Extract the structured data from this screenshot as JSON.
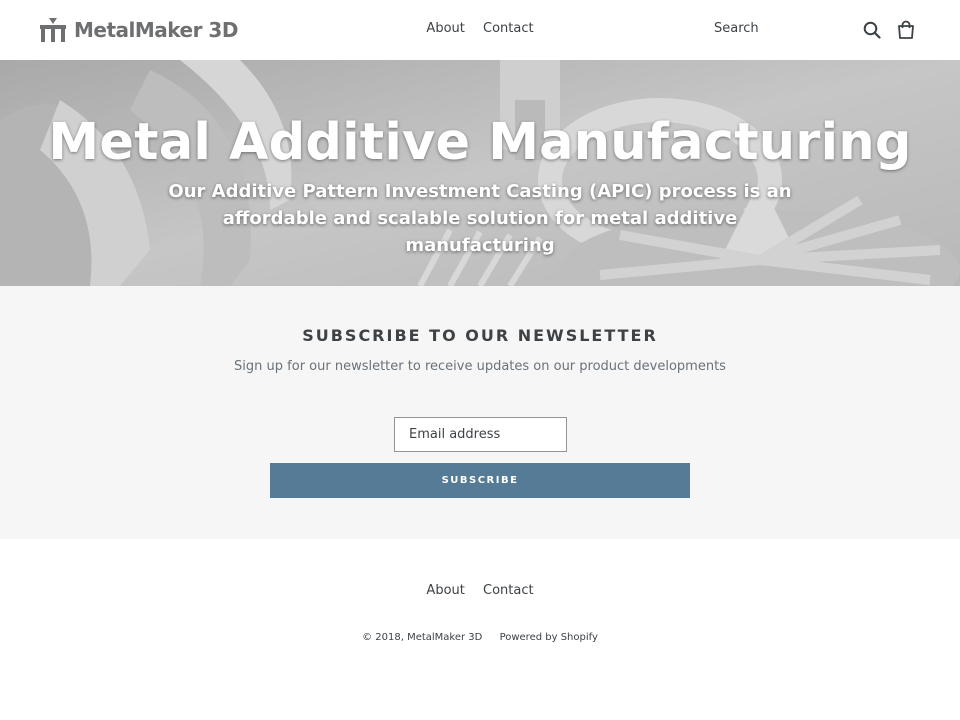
{
  "header": {
    "logo_text": "MetalMaker 3D",
    "nav": [
      "About",
      "Contact"
    ],
    "search_label": "Search",
    "icons": [
      "search-icon",
      "cart-icon"
    ]
  },
  "hero": {
    "title": "Metal Additive Manufacturing",
    "subtitle": "Our Additive Pattern Investment Casting (APIC) process is an affordable and scalable solution for metal additive manufacturing"
  },
  "newsletter": {
    "title": "SUBSCRIBE TO OUR NEWSLETTER",
    "text": "Sign up for our newsletter to receive updates on our product developments",
    "email_placeholder": "Email address",
    "button_label": "SUBSCRIBE"
  },
  "footer": {
    "nav": [
      "About",
      "Contact"
    ],
    "copyright": "© 2018, MetalMaker 3D",
    "powered_by": "Powered by Shopify"
  },
  "colors": {
    "accent": "#557b97",
    "text": "#3d4246",
    "newsletter_bg": "#f6f6f6"
  }
}
